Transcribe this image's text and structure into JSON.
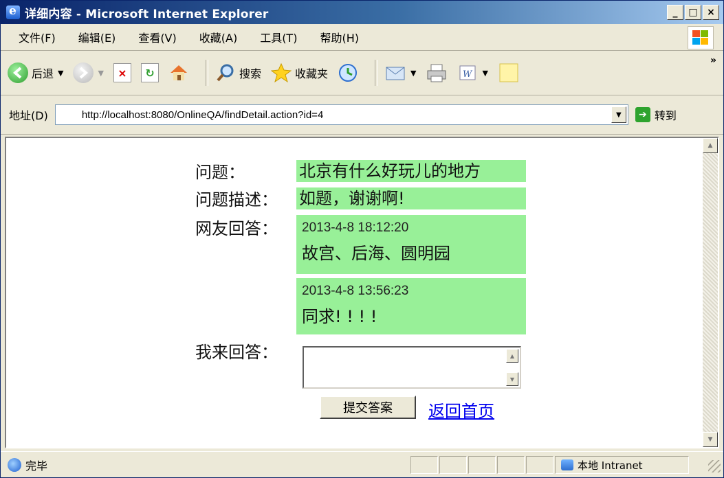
{
  "window": {
    "title": "详细内容 - Microsoft Internet Explorer",
    "controls": [
      "_",
      "□",
      "×"
    ]
  },
  "menu": [
    "文件(F)",
    "编辑(E)",
    "查看(V)",
    "收藏(A)",
    "工具(T)",
    "帮助(H)"
  ],
  "toolbar": {
    "back_label": "后退",
    "search_label": "搜索",
    "favorites_label": "收藏夹",
    "more": "»"
  },
  "address": {
    "label": "地址(D)",
    "url": "http://localhost:8080/OnlineQA/findDetail.action?id=4",
    "go_label": "转到"
  },
  "page": {
    "question_label": "问题：",
    "question": "北京有什么好玩儿的地方",
    "description_label": "问题描述：",
    "description": "如题，谢谢啊!",
    "answers_label": "网友回答：",
    "answers": [
      {
        "time": "2013-4-8 18:12:20",
        "text": "故宫、后海、圆明园"
      },
      {
        "time": "2013-4-8 13:56:23",
        "text": "同求! ! ! !"
      }
    ],
    "reply_label": "我来回答：",
    "reply_value": "",
    "submit_label": "提交答案",
    "home_link": "返回首页"
  },
  "status": {
    "text": "完毕",
    "zone": "本地 Intranet"
  },
  "colors": {
    "highlight": "#98f098",
    "link": "#0000ee",
    "titlebar": "#0a246a"
  }
}
